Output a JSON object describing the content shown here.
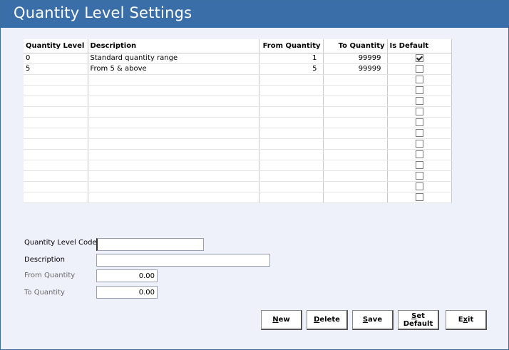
{
  "window": {
    "title": "Quantity Level Settings"
  },
  "grid": {
    "columns": [
      "Quantity Level",
      "Description",
      "From Quantity",
      "To Quantity",
      "Is Default"
    ],
    "rows": [
      {
        "level": "0",
        "description": "Standard quantity range",
        "from": "1",
        "to": "99999",
        "is_default": true
      },
      {
        "level": "5",
        "description": "From 5 & above",
        "from": "5",
        "to": "99999",
        "is_default": false
      },
      {
        "level": "",
        "description": "",
        "from": "",
        "to": "",
        "is_default": false
      },
      {
        "level": "",
        "description": "",
        "from": "",
        "to": "",
        "is_default": false
      },
      {
        "level": "",
        "description": "",
        "from": "",
        "to": "",
        "is_default": false
      },
      {
        "level": "",
        "description": "",
        "from": "",
        "to": "",
        "is_default": false
      },
      {
        "level": "",
        "description": "",
        "from": "",
        "to": "",
        "is_default": false
      },
      {
        "level": "",
        "description": "",
        "from": "",
        "to": "",
        "is_default": false
      },
      {
        "level": "",
        "description": "",
        "from": "",
        "to": "",
        "is_default": false
      },
      {
        "level": "",
        "description": "",
        "from": "",
        "to": "",
        "is_default": false
      },
      {
        "level": "",
        "description": "",
        "from": "",
        "to": "",
        "is_default": false
      },
      {
        "level": "",
        "description": "",
        "from": "",
        "to": "",
        "is_default": false
      },
      {
        "level": "",
        "description": "",
        "from": "",
        "to": "",
        "is_default": false
      },
      {
        "level": "",
        "description": "",
        "from": "",
        "to": "",
        "is_default": false
      }
    ]
  },
  "form": {
    "code_label": "Quantity Level Code",
    "code_value": "",
    "description_label": "Description",
    "description_value": "",
    "from_label": "From Quantity",
    "from_value": "0.00",
    "to_label": "To Quantity",
    "to_value": "0.00"
  },
  "buttons": {
    "new": {
      "accel": "N",
      "rest": "ew"
    },
    "delete": {
      "accel": "D",
      "rest": "elete"
    },
    "save": {
      "accel": "S",
      "rest": "ave"
    },
    "set_default": {
      "line1_accel": "S",
      "line1_rest": "et",
      "line2": "Default"
    },
    "exit": {
      "pre": "E",
      "accel": "x",
      "rest": "it"
    }
  }
}
